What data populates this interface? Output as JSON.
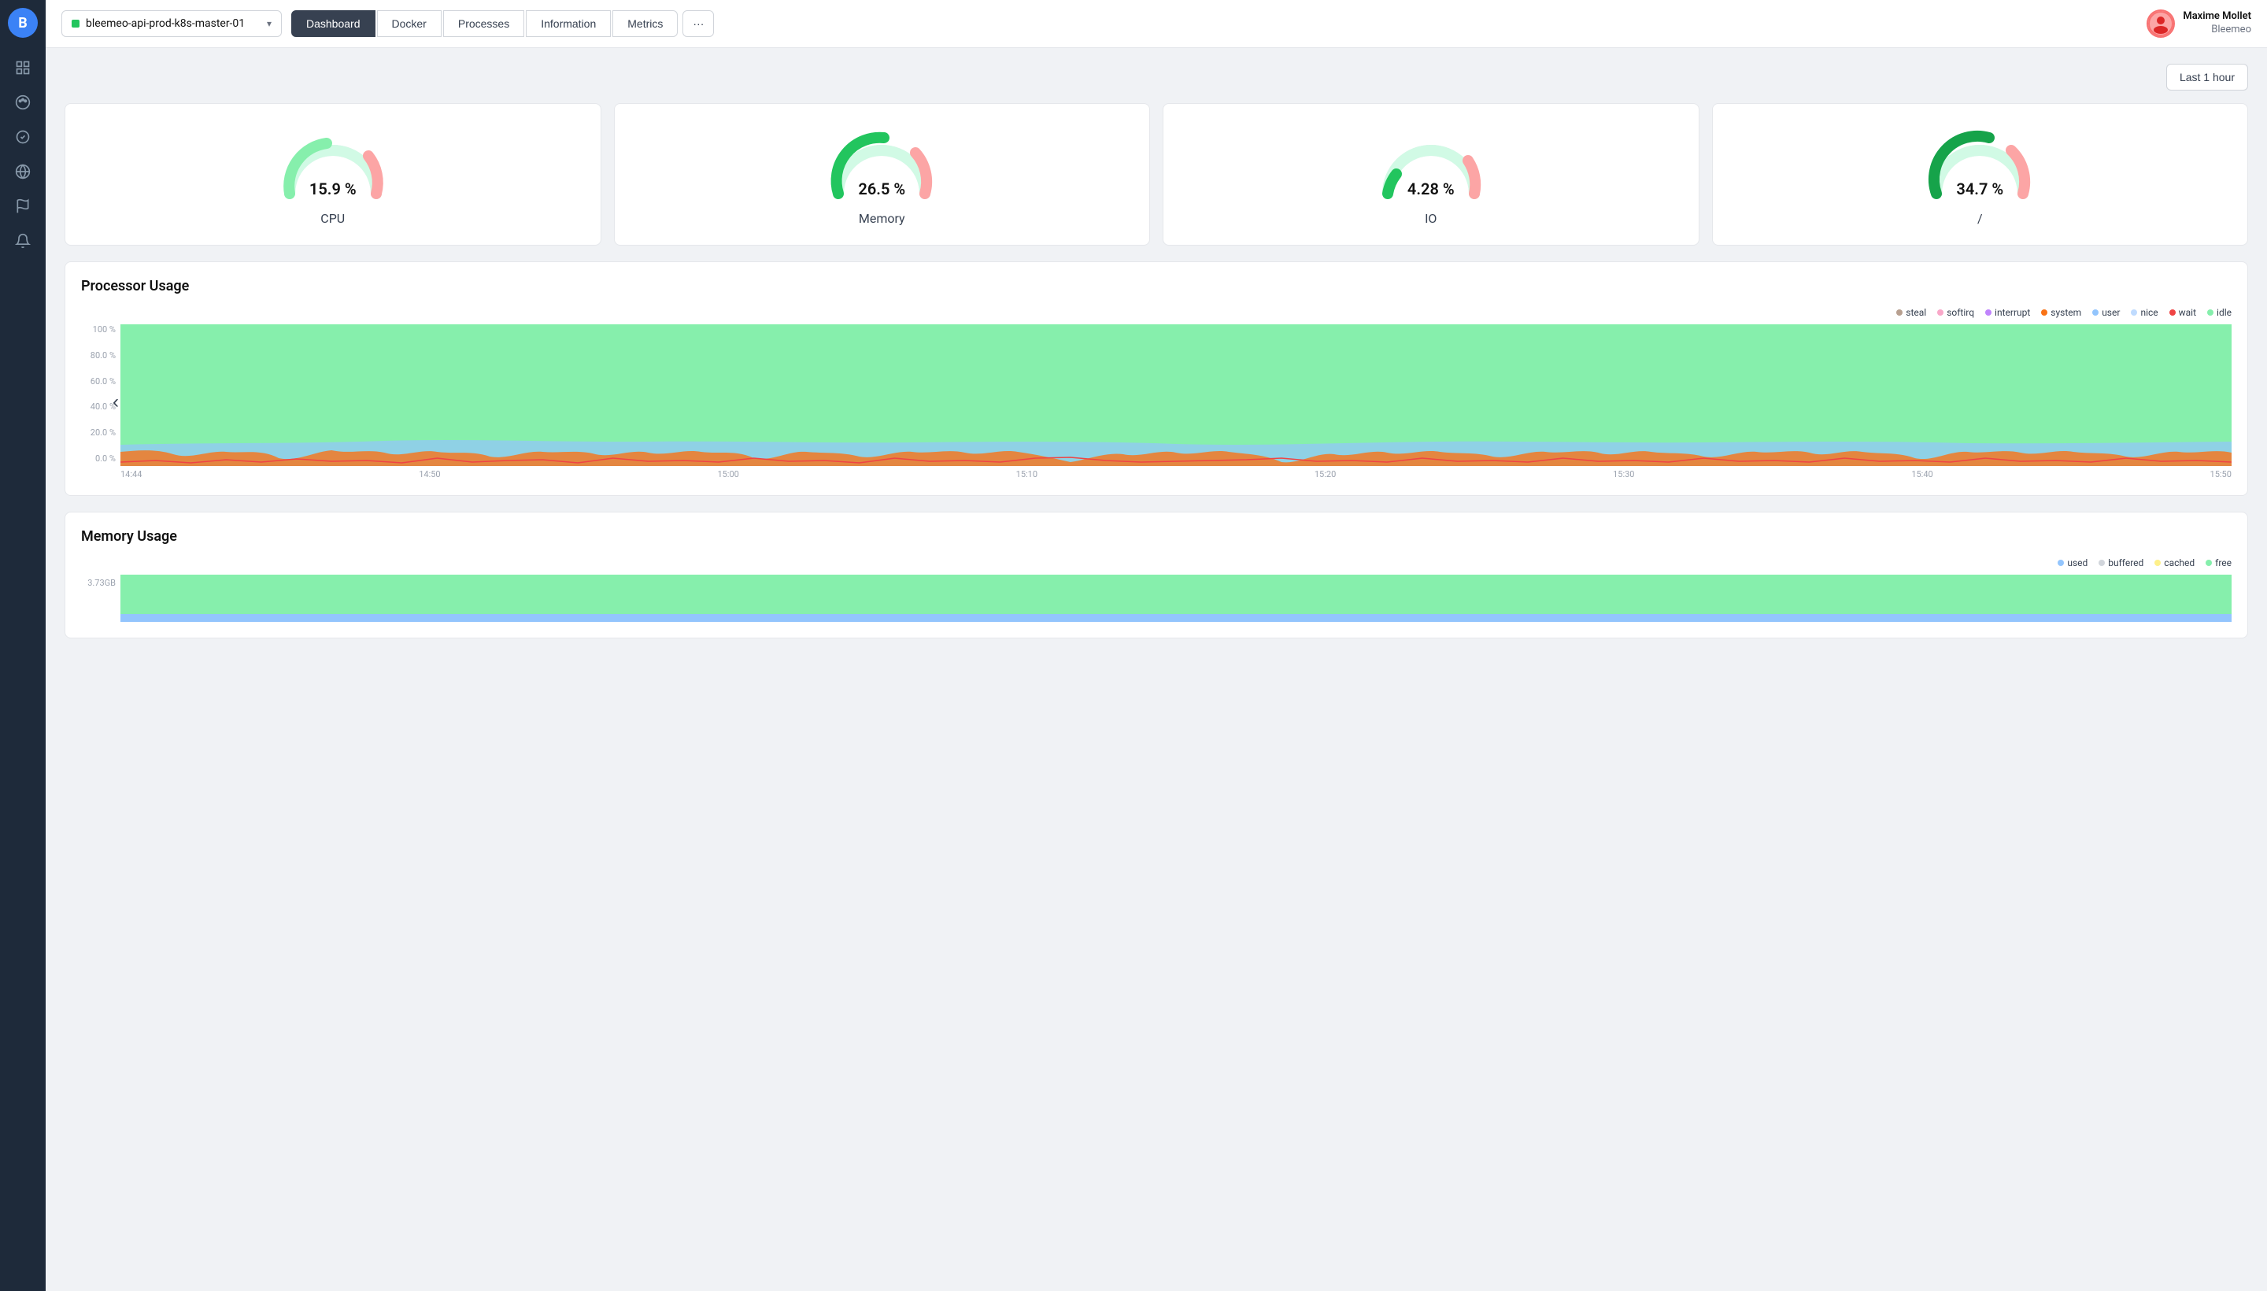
{
  "app": {
    "logo": "B",
    "logoColor": "#3b82f6"
  },
  "sidebar": {
    "items": [
      {
        "id": "grid",
        "icon": "grid"
      },
      {
        "id": "palette",
        "icon": "palette"
      },
      {
        "id": "check",
        "icon": "check"
      },
      {
        "id": "globe",
        "icon": "globe"
      },
      {
        "id": "flag",
        "icon": "flag"
      },
      {
        "id": "bell",
        "icon": "bell"
      }
    ]
  },
  "header": {
    "host": {
      "name": "bleemeo-api-prod-k8s-master-01",
      "status": "green"
    },
    "tabs": [
      {
        "id": "dashboard",
        "label": "Dashboard",
        "active": true
      },
      {
        "id": "docker",
        "label": "Docker",
        "active": false
      },
      {
        "id": "processes",
        "label": "Processes",
        "active": false
      },
      {
        "id": "information",
        "label": "Information",
        "active": false
      },
      {
        "id": "metrics",
        "label": "Metrics",
        "active": false
      }
    ],
    "more_label": "···",
    "user": {
      "name": "Maxime Mollet",
      "org": "Bleemeo"
    }
  },
  "time_range": {
    "label": "Last 1 hour"
  },
  "gauges": [
    {
      "id": "cpu",
      "value": "15.9 %",
      "label": "CPU",
      "mainArc": 0.159,
      "color": "#86c96e"
    },
    {
      "id": "memory",
      "value": "26.5 %",
      "label": "Memory",
      "mainArc": 0.265,
      "color": "#22c55e"
    },
    {
      "id": "io",
      "value": "4.28 %",
      "label": "IO",
      "mainArc": 0.0428,
      "color": "#22c55e"
    },
    {
      "id": "slash",
      "value": "34.7 %",
      "label": "/",
      "mainArc": 0.347,
      "color": "#16a34a"
    }
  ],
  "processor_chart": {
    "title": "Processor Usage",
    "legend": [
      {
        "label": "steal",
        "color": "#b8a090"
      },
      {
        "label": "softirq",
        "color": "#f9a8c9"
      },
      {
        "label": "interrupt",
        "color": "#c084fc"
      },
      {
        "label": "system",
        "color": "#f97316"
      },
      {
        "label": "user",
        "color": "#93c5fd"
      },
      {
        "label": "nice",
        "color": "#bfdbfe"
      },
      {
        "label": "wait",
        "color": "#ef4444"
      },
      {
        "label": "idle",
        "color": "#86efac"
      }
    ],
    "y_labels": [
      "100 %",
      "80.0 %",
      "60.0 %",
      "40.0 %",
      "20.0 %",
      "0.0 %"
    ],
    "x_labels": [
      "14:44",
      "14:50",
      "15:00",
      "15:10",
      "15:20",
      "15:30",
      "15:40",
      "15:50"
    ]
  },
  "memory_chart": {
    "title": "Memory Usage",
    "legend": [
      {
        "label": "used",
        "color": "#93c5fd"
      },
      {
        "label": "buffered",
        "color": "#d1d5db"
      },
      {
        "label": "cached",
        "color": "#fef08a"
      },
      {
        "label": "free",
        "color": "#86efac"
      }
    ],
    "y_label_top": "3.73GB"
  }
}
